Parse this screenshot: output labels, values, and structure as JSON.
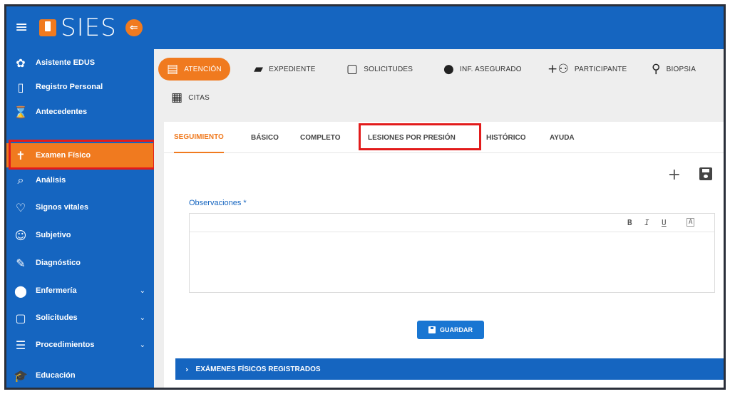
{
  "header": {
    "menu_icon": "hamburger-icon",
    "app_name": "SIES",
    "collapse_icon": "arrow-left-circle-icon",
    "colors": {
      "primary": "#1565c0",
      "accent": "#f07a1f",
      "highlight": "#e21b1b"
    }
  },
  "sidebar": {
    "items": [
      {
        "label": "Asistente EDUS",
        "icon": "gear-icon"
      },
      {
        "label": "Registro Personal",
        "icon": "tablet-icon"
      },
      {
        "label": "Antecedentes",
        "icon": "hourglass-icon"
      },
      {
        "label": "Examen Físico",
        "icon": "person-icon",
        "active": true
      },
      {
        "label": "Análisis",
        "icon": "zoom-icon"
      },
      {
        "label": "Signos vitales",
        "icon": "heart-icon"
      },
      {
        "label": "Subjetivo",
        "icon": "smile-icon"
      },
      {
        "label": "Diagnóstico",
        "icon": "pencil-icon"
      },
      {
        "label": "Enfermería",
        "icon": "location-icon",
        "expandable": true
      },
      {
        "label": "Solicitudes",
        "icon": "inbox-icon",
        "expandable": true
      },
      {
        "label": "Procedimientos",
        "icon": "list-icon",
        "expandable": true
      },
      {
        "label": "Educación",
        "icon": "graduation-cap-icon"
      }
    ]
  },
  "toolbar": {
    "buttons": [
      {
        "label": "ATENCIÓN",
        "icon": "id-card-icon",
        "active": true
      },
      {
        "label": "EXPEDIENTE",
        "icon": "folder-icon"
      },
      {
        "label": "SOLICITUDES",
        "icon": "inbox-icon"
      },
      {
        "label": "INF. ASEGURADO",
        "icon": "person-icon"
      },
      {
        "label": "PARTICIPANTE",
        "icon": "add-group-icon"
      },
      {
        "label": "BIOPSIA",
        "icon": "microscope-icon"
      },
      {
        "label": "CITAS",
        "icon": "calendar-icon"
      }
    ]
  },
  "tabs": [
    {
      "label": "SEGUIMIENTO",
      "active": true
    },
    {
      "label": "BÁSICO"
    },
    {
      "label": "COMPLETO"
    },
    {
      "label": "LESIONES POR PRESIÓN",
      "highlighted": true
    },
    {
      "label": "HISTÓRICO"
    },
    {
      "label": "AYUDA"
    }
  ],
  "form": {
    "add_icon": "plus-icon",
    "save_icon": "save-icon",
    "observaciones_label": "Observaciones *",
    "editor_toolbar": {
      "bold": "B",
      "italic": "I",
      "underline": "U",
      "clear": "A"
    },
    "editor_value": "",
    "save_button_label": "GUARDAR"
  },
  "accordion": {
    "icon": "chevron-right-icon",
    "label": "EXÁMENES FÍSICOS REGISTRADOS"
  }
}
